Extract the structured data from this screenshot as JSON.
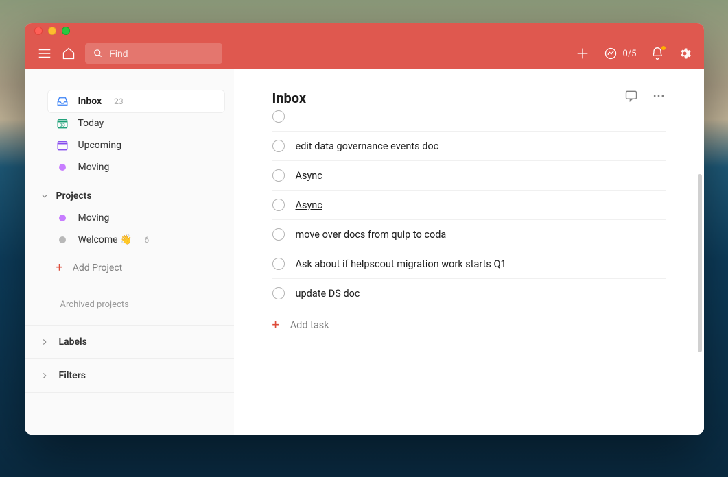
{
  "search": {
    "placeholder": "Find"
  },
  "productivity": {
    "count": "0/5"
  },
  "sidebar": {
    "items": [
      {
        "label": "Inbox",
        "count": "23"
      },
      {
        "label": "Today"
      },
      {
        "label": "Upcoming"
      }
    ],
    "favorites": [
      {
        "label": "Moving",
        "color": "#c77dff"
      }
    ],
    "projects_header": "Projects",
    "projects": [
      {
        "label": "Moving",
        "color": "#c77dff"
      },
      {
        "label": "Welcome 👋",
        "count": "6",
        "color": "#b8b8b8"
      }
    ],
    "add_project": "Add Project",
    "archived": "Archived projects",
    "labels": "Labels",
    "filters": "Filters"
  },
  "main": {
    "title": "Inbox",
    "tasks": [
      {
        "label": "(cut off)",
        "link": false,
        "cut": true
      },
      {
        "label": "edit data governance events doc",
        "link": false
      },
      {
        "label": "Async",
        "link": true
      },
      {
        "label": "Async",
        "link": true
      },
      {
        "label": "move over docs from quip to coda",
        "link": false
      },
      {
        "label": "Ask about if helpscout migration work starts Q1",
        "link": false
      },
      {
        "label": "update DS doc",
        "link": false
      }
    ],
    "add_task": "Add task"
  }
}
